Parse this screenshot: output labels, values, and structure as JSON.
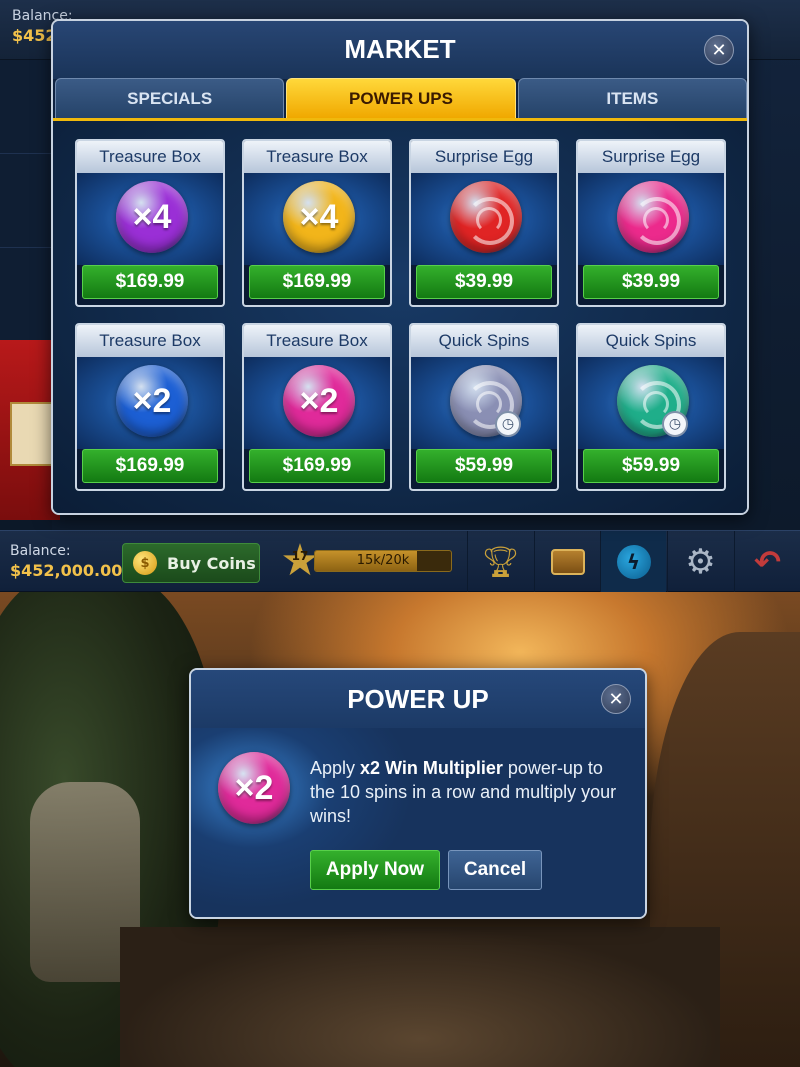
{
  "background": {
    "balance_label": "Balance:",
    "balance_value": "$452,000.00"
  },
  "market": {
    "title": "MARKET",
    "close_icon": "close-icon",
    "tabs": [
      {
        "label": "SPECIALS",
        "active": false
      },
      {
        "label": "POWER UPS",
        "active": true
      },
      {
        "label": "ITEMS",
        "active": false
      }
    ],
    "items": [
      {
        "title": "Treasure Box",
        "badge": "×4",
        "orb_color": "#9a2fd6",
        "price": "$169.99",
        "icon": "multiplier-orb-icon"
      },
      {
        "title": "Treasure Box",
        "badge": "×4",
        "orb_color": "#f2b51a",
        "price": "$169.99",
        "icon": "multiplier-orb-icon"
      },
      {
        "title": "Surprise Egg",
        "badge": "",
        "orb_color": "#e02424",
        "price": "$39.99",
        "icon": "swirl-orb-icon"
      },
      {
        "title": "Surprise Egg",
        "badge": "",
        "orb_color": "#ec2a8c",
        "price": "$39.99",
        "icon": "swirl-orb-icon"
      },
      {
        "title": "Treasure Box",
        "badge": "×2",
        "orb_color": "#1c5fd4",
        "price": "$169.99",
        "icon": "multiplier-orb-icon"
      },
      {
        "title": "Treasure Box",
        "badge": "×2",
        "orb_color": "#e02a9a",
        "price": "$169.99",
        "icon": "multiplier-orb-icon"
      },
      {
        "title": "Quick Spins",
        "badge": "",
        "orb_color": "#8a8fb4",
        "price": "$59.99",
        "icon": "swirl-clock-orb-icon"
      },
      {
        "title": "Quick Spins",
        "badge": "",
        "orb_color": "#1fae8a",
        "price": "$59.99",
        "icon": "swirl-clock-orb-icon"
      }
    ]
  },
  "hud": {
    "balance_label": "Balance:",
    "balance_value": "$452,000.00",
    "buy_coins_label": "Buy Coins",
    "coin_icon": "$",
    "level": "17",
    "xp_text": "15k/20k",
    "xp_progress": 0.75
  },
  "powerup": {
    "title": "POWER UP",
    "badge": "×2",
    "orb_color": "#e02a9a",
    "desc_prefix": "Apply ",
    "desc_bold": "x2 Win Multiplier",
    "desc_suffix": " power-up to the 10 spins in a row and multiply your wins!",
    "apply_label": "Apply Now",
    "cancel_label": "Cancel"
  }
}
